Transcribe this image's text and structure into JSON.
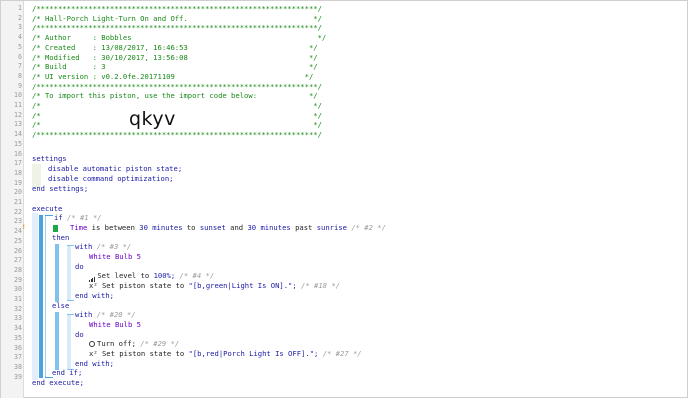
{
  "editor": {
    "line_numbers": [
      "1",
      "2",
      "3",
      "4",
      "5",
      "6",
      "7",
      "8",
      "9",
      "10",
      "11",
      "12",
      "13",
      "14",
      "15",
      "16",
      "17",
      "18",
      "19",
      "20",
      "21",
      "22",
      "23",
      "24",
      "25",
      "26",
      "27",
      "28",
      "29",
      "30",
      "31",
      "32",
      "33",
      "34",
      "35",
      "36",
      "37",
      "38",
      "39"
    ],
    "error_marker_line": "23",
    "header": {
      "border": "/*****************************************************************/",
      "title": "/* Hall-Porch Light-Turn On and Off.                             */",
      "author": "/* Author     : Bobbles                                           */",
      "created": "/* Created    : 13/08/2017, 16:46:53                            */",
      "modified": "/* Modified   : 30/10/2017, 13:56:08                            */",
      "build": "/* Build      : 3                                               */",
      "ui_version": "/* UI version : v0.2.0fe.20171109                              */",
      "import_note": "/* To import this piston, use the import code below:            */",
      "blank1": "/*                                                               */",
      "blank2": "/*                                                               */",
      "blank3": "/*                                                               */",
      "import_code": "qkyv"
    },
    "settings": {
      "open": "settings",
      "line1": "disable automatic piston state;",
      "line2": "disable command optimization;",
      "close": "end settings;"
    },
    "execute": {
      "open": "execute",
      "if_kw": "if",
      "if_comment": "/* #1 */",
      "cond_time": "Time",
      "cond_between": "is between",
      "cond_a_num": "30",
      "cond_a_unit": "minutes",
      "cond_to": "to",
      "cond_sunset": "sunset",
      "cond_and": "and",
      "cond_b_num": "30",
      "cond_b_unit": "minutes",
      "cond_past": "past",
      "cond_sunrise": "sunrise",
      "cond_comment": "/* #2 */",
      "then_kw": "then",
      "with1_kw": "with",
      "with1_comment": "/* #3 */",
      "device1": "White Bulb 5",
      "do1_kw": "do",
      "set_level_text": "Set level to",
      "set_level_value": "100%;",
      "set_level_comment": "/* #4 */",
      "set_state1_prefix": "x² Set piston state to",
      "set_state1_value": "\"[b,green|Light Is ON].\";",
      "set_state1_comment": "/* #18 */",
      "endwith1": "end with;",
      "else_kw": "else",
      "with2_kw": "with",
      "with2_comment": "/* #20 */",
      "device2": "White Bulb 5",
      "do2_kw": "do",
      "turn_off_text": "Turn off;",
      "turn_off_comment": "/* #29 */",
      "set_state2_prefix": "x² Set piston state to",
      "set_state2_value": "\"[b,red|Porch Light Is OFF].\";",
      "set_state2_comment": "/* #27 */",
      "endwith2": "end with;",
      "endif": "end if;",
      "close": "end execute;"
    }
  },
  "colors": {
    "comment": "#178a17",
    "keyword": "#1a1aa6",
    "device": "#6a00c8",
    "bar_if": "#4aa3df",
    "bar_with": "#7fc2ee",
    "check": "#1fa54a"
  }
}
